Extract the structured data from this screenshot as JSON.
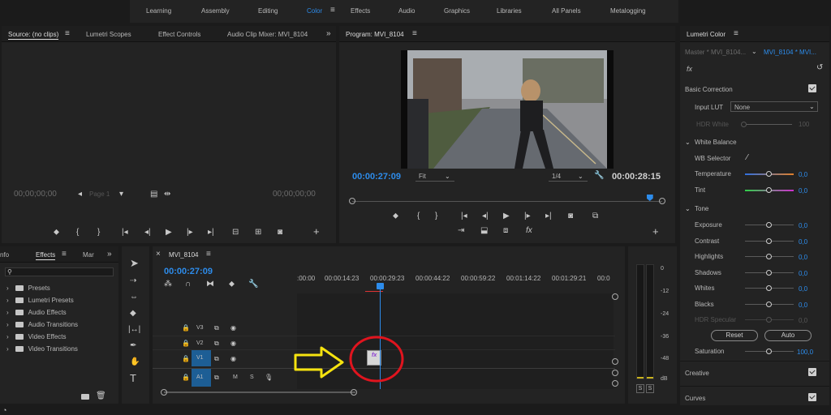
{
  "workspaces": {
    "items": [
      "Learning",
      "Assembly",
      "Editing",
      "Color",
      "Effects",
      "Audio",
      "Graphics",
      "Libraries",
      "All Panels",
      "Metalogging"
    ],
    "active": "Color"
  },
  "source_panel": {
    "tabs": [
      "Source: (no clips)",
      "Lumetri Scopes",
      "Effect Controls",
      "Audio Clip Mixer: MVI_8104"
    ],
    "timecode_left": "00;00;00;00",
    "timecode_right": "00;00;00;00",
    "page": "Page 1"
  },
  "program_panel": {
    "title": "Program: MVI_8104",
    "timecode_current": "00:00:27:09",
    "timecode_duration": "00:00:28:15",
    "zoom": "Fit",
    "resolution": "1/4",
    "playhead_position": 0.96
  },
  "lumetri": {
    "title": "Lumetri Color",
    "master_clip": "Master * MVI_8104...",
    "active_clip": "MVI_8104 * MVI...",
    "fx_label": "fx",
    "basic_correction": "Basic Correction",
    "input_lut_label": "Input LUT",
    "input_lut_value": "None",
    "hdr_white_label": "HDR White",
    "hdr_white_value": "100",
    "white_balance": "White Balance",
    "wb_selector": "WB Selector",
    "temperature_label": "Temperature",
    "temperature_value": "0,0",
    "tint_label": "Tint",
    "tint_value": "0,0",
    "tone": "Tone",
    "exposure_label": "Exposure",
    "exposure_value": "0,0",
    "contrast_label": "Contrast",
    "contrast_value": "0,0",
    "highlights_label": "Highlights",
    "highlights_value": "0,0",
    "shadows_label": "Shadows",
    "shadows_value": "0,0",
    "whites_label": "Whites",
    "whites_value": "0,0",
    "blacks_label": "Blacks",
    "blacks_value": "0,0",
    "hdr_specular_label": "HDR Specular",
    "hdr_specular_value": "0,0",
    "reset_label": "Reset",
    "auto_label": "Auto",
    "saturation_label": "Saturation",
    "saturation_value": "100,0",
    "creative": "Creative",
    "curves": "Curves"
  },
  "effects_panel": {
    "tabs": [
      "nfo",
      "Effects",
      "Mar"
    ],
    "items": [
      "Presets",
      "Lumetri Presets",
      "Audio Effects",
      "Audio Transitions",
      "Video Effects",
      "Video Transitions"
    ]
  },
  "timeline": {
    "title": "MVI_8104",
    "timecode": "00:00:27:09",
    "ruler": [
      ":00:00",
      "00:00:14:23",
      "00:00:29:23",
      "00:00:44:22",
      "00:00:59:22",
      "00:01:14:22",
      "00:01:29:21",
      "00:0"
    ],
    "tracks": {
      "v3": "V3",
      "v2": "V2",
      "v1": "V1",
      "a1": "A1",
      "m": "M",
      "s": "S"
    },
    "clip_label": "fx"
  },
  "audio_meter": {
    "scale": [
      "0",
      "-12",
      "-24",
      "-36",
      "-48",
      "dB"
    ],
    "solo_left": "S",
    "solo_right": "S"
  },
  "colors": {
    "accent_blue": "#2d8ceb",
    "annotation_red": "#e0141e",
    "annotation_yellow": "#f6e30f",
    "track_blue": "#1d5e95"
  }
}
